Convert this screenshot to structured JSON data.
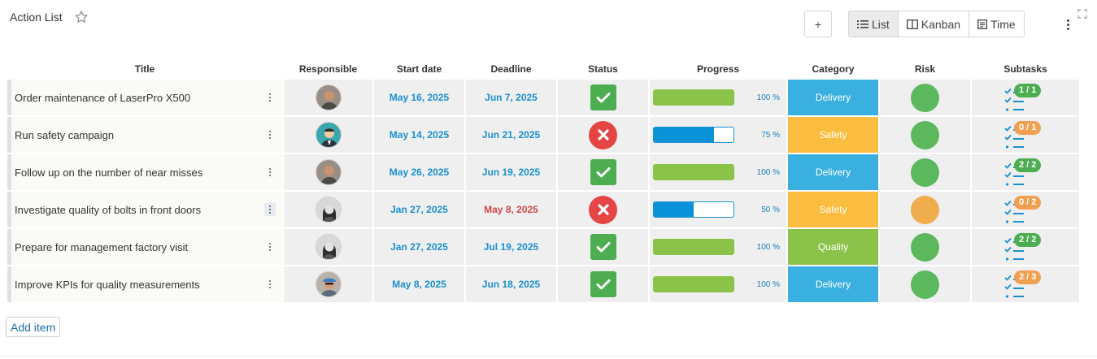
{
  "header": {
    "title": "Action List"
  },
  "toolbar": {
    "add_label": "+",
    "views": [
      {
        "label": "List",
        "icon": "list-icon"
      },
      {
        "label": "Kanban",
        "icon": "kanban-icon"
      },
      {
        "label": "Time",
        "icon": "time-icon"
      }
    ]
  },
  "table": {
    "columns": [
      "Title",
      "Responsible",
      "Start date",
      "Deadline",
      "Status",
      "Progress",
      "Category",
      "Risk",
      "Subtasks"
    ],
    "rows": [
      {
        "title": "Order maintenance of LaserPro X500",
        "start": "May 16, 2025",
        "deadline": "Jun 7, 2025",
        "deadline_overdue": false,
        "status": "done",
        "progress": 1.0,
        "progress_label": "100 %",
        "category": "Delivery",
        "category_color": "#3ab0e0",
        "risk_color": "#5cb85c",
        "subtasks": "1 / 1",
        "subtasks_color": "#4cae50"
      },
      {
        "title": "Run safety campaign",
        "start": "May 14, 2025",
        "deadline": "Jun 21, 2025",
        "deadline_overdue": false,
        "status": "failed",
        "progress": 0.75,
        "progress_label": "75 %",
        "category": "Safety",
        "category_color": "#fbbd3f",
        "risk_color": "#5cb85c",
        "subtasks": "0 / 1",
        "subtasks_color": "#f0a050"
      },
      {
        "title": "Follow up on the number of near misses",
        "start": "May 26, 2025",
        "deadline": "Jun 19, 2025",
        "deadline_overdue": false,
        "status": "done",
        "progress": 1.0,
        "progress_label": "100 %",
        "category": "Delivery",
        "category_color": "#3ab0e0",
        "risk_color": "#5cb85c",
        "subtasks": "2 / 2",
        "subtasks_color": "#4cae50"
      },
      {
        "title": "Investigate quality of bolts in front doors",
        "start": "Jan 27, 2025",
        "deadline": "May 8, 2025",
        "deadline_overdue": true,
        "status": "failed",
        "progress": 0.5,
        "progress_label": "50 %",
        "category": "Safety",
        "category_color": "#fbbd3f",
        "risk_color": "#f0ad4e",
        "subtasks": "0 / 2",
        "subtasks_color": "#f0a050"
      },
      {
        "title": "Prepare for management factory visit",
        "start": "Jan 27, 2025",
        "deadline": "Jul 19, 2025",
        "deadline_overdue": false,
        "status": "done",
        "progress": 1.0,
        "progress_label": "100 %",
        "category": "Quality",
        "category_color": "#8bc34a",
        "risk_color": "#5cb85c",
        "subtasks": "2 / 2",
        "subtasks_color": "#4cae50"
      },
      {
        "title": "Improve KPIs for quality measurements",
        "start": "May 8, 2025",
        "deadline": "Jun 18, 2025",
        "deadline_overdue": false,
        "status": "done",
        "progress": 1.0,
        "progress_label": "100 %",
        "category": "Delivery",
        "category_color": "#3ab0e0",
        "risk_color": "#5cb85c",
        "subtasks": "2 / 3",
        "subtasks_color": "#f0a050"
      }
    ]
  },
  "footer": {
    "add_item_label": "Add item"
  }
}
